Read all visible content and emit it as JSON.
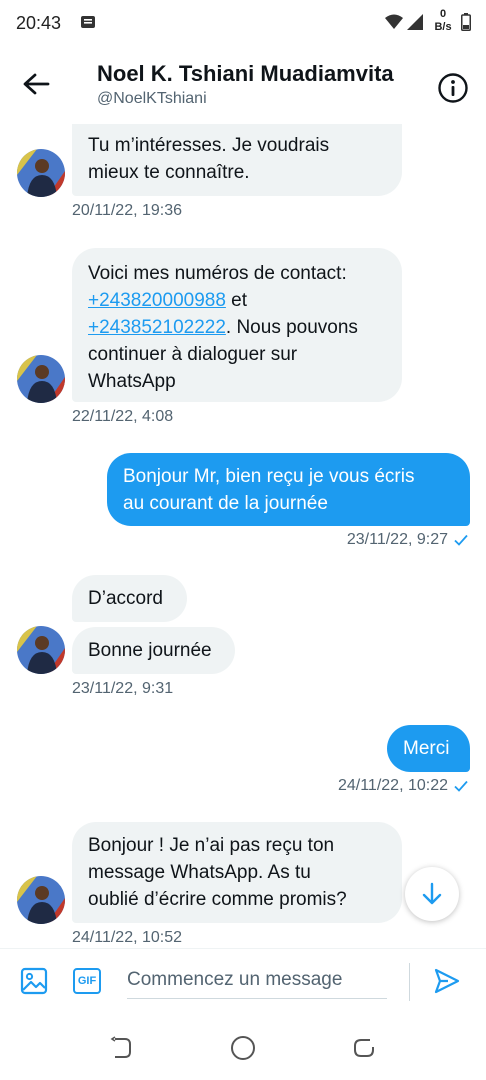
{
  "status_bar": {
    "time": "20:43",
    "net_speed_value": "0",
    "net_speed_unit": "B/s"
  },
  "header": {
    "name": "Noel K. Tshiani Muadiamvita",
    "handle": "@NoelKTshiani",
    "back_icon": "arrow-left-icon",
    "info_icon": "info-circle-icon"
  },
  "messages": [
    {
      "direction": "in",
      "text": "Tu m’intéresses. Je voudrais mieux te connaître.",
      "line1": "Tu m’intéresses. Je voudrais",
      "line2": "mieux te connaître.",
      "timestamp": "20/11/22, 19:36"
    },
    {
      "direction": "in",
      "line1": "Voici mes numéros de contact:",
      "phone1": "+243820000988",
      "after_phone1": " et",
      "phone2": "+243852102222",
      "after_phone2": ". Nous pouvons",
      "line4": "continuer à dialoguer sur",
      "line5": "WhatsApp",
      "timestamp": "22/11/22, 4:08"
    },
    {
      "direction": "out",
      "line1": "Bonjour Mr, bien reçu je vous écris",
      "line2": "au courant de la journée",
      "timestamp": "23/11/22, 9:27"
    },
    {
      "direction": "in",
      "text": "D’accord"
    },
    {
      "direction": "in",
      "text": "Bonne journée",
      "timestamp": "23/11/22, 9:31"
    },
    {
      "direction": "out",
      "text": "Merci",
      "timestamp": "24/11/22, 10:22"
    },
    {
      "direction": "in",
      "line1": "Bonjour ! Je n’ai pas reçu ton",
      "line2": "message WhatsApp. As tu",
      "line3": "oublié d’écrire comme promis?",
      "timestamp": "24/11/22, 10:52"
    }
  ],
  "composer": {
    "placeholder": "Commencez un message",
    "gif_label": "GIF",
    "media_icon": "image-icon",
    "send_icon": "send-icon"
  },
  "colors": {
    "accent": "#1d9bf0",
    "incoming_bubble": "#eff3f4",
    "secondary_text": "#536471"
  }
}
